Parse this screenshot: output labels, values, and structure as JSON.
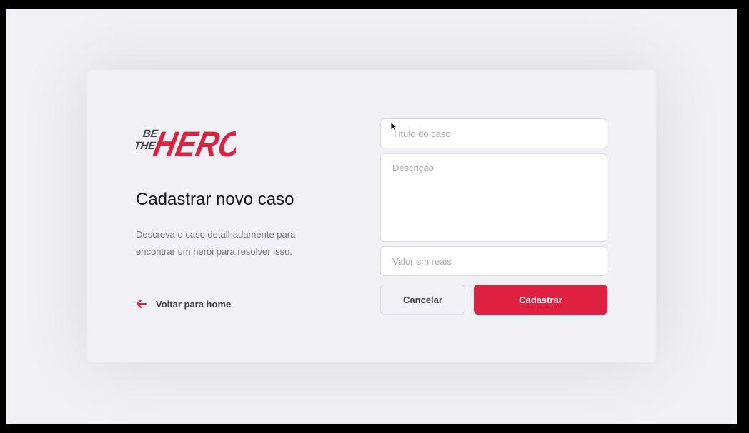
{
  "logo": {
    "line1": "BE",
    "line2": "THE",
    "word": "HERO",
    "color": "#e02041"
  },
  "page": {
    "title": "Cadastrar novo caso",
    "description": "Descreva o caso detalhadamente para encontrar um herói para resolver isso.",
    "back_link": "Voltar para home",
    "back_icon": "arrow-left-icon"
  },
  "form": {
    "title_placeholder": "Título do caso",
    "description_placeholder": "Descrição",
    "value_placeholder": "Valor em reais",
    "cancel_label": "Cancelar",
    "submit_label": "Cadastrar"
  },
  "colors": {
    "accent": "#e02041",
    "background": "#f0f0f5",
    "text_dark": "#13131a",
    "text_muted": "#737380"
  }
}
